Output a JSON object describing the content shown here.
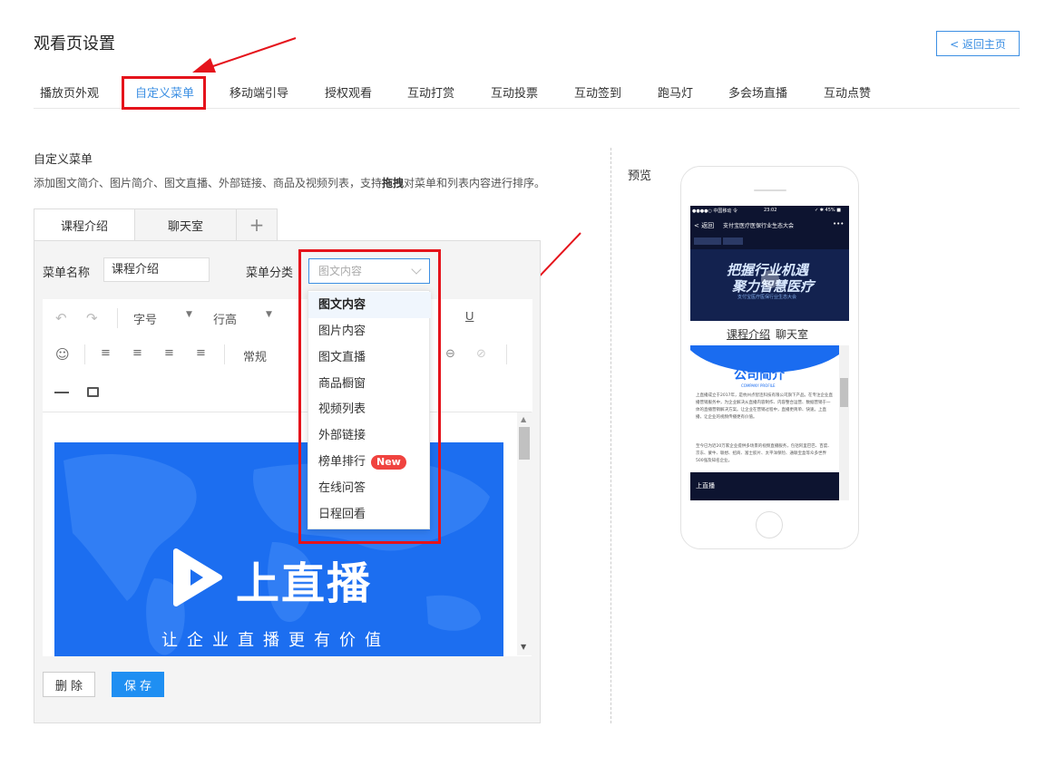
{
  "header": {
    "title": "观看页设置",
    "back_label": "< 返回主页"
  },
  "tabs": [
    {
      "label": "播放页外观"
    },
    {
      "label": "自定义菜单"
    },
    {
      "label": "移动端引导"
    },
    {
      "label": "授权观看"
    },
    {
      "label": "互动打赏"
    },
    {
      "label": "互动投票"
    },
    {
      "label": "互动签到"
    },
    {
      "label": "跑马灯"
    },
    {
      "label": "多会场直播"
    },
    {
      "label": "互动点赞"
    }
  ],
  "section": {
    "title": "自定义菜单",
    "desc_pre": "添加图文简介、图片简介、图文直播、外部链接、商品及视频列表，支持",
    "desc_bold": "拖拽",
    "desc_post": "对菜单和列表内容进行排序。"
  },
  "menu_tabs": [
    {
      "label": "课程介绍"
    },
    {
      "label": "聊天室"
    },
    {
      "label": "+"
    }
  ],
  "form": {
    "name_label": "菜单名称",
    "name_value": "课程介绍",
    "category_label": "菜单分类",
    "category_placeholder": "图文内容"
  },
  "dropdown": {
    "options": [
      {
        "label": "图文内容"
      },
      {
        "label": "图片内容"
      },
      {
        "label": "图文直播"
      },
      {
        "label": "商品橱窗"
      },
      {
        "label": "视频列表"
      },
      {
        "label": "外部链接"
      },
      {
        "label": "榜单排行",
        "badge": "New"
      },
      {
        "label": "在线问答"
      },
      {
        "label": "日程回看"
      }
    ]
  },
  "toolbar": {
    "font_size_label": "字号",
    "line_height_label": "行高",
    "paragraph_label": "常规"
  },
  "banner": {
    "brand": "上直播",
    "slogan": "让企业直播更有价值"
  },
  "buttons": {
    "delete_label": "删 除",
    "save_label": "保 存"
  },
  "preview": {
    "label": "预览",
    "status_carrier": "●●●●○ 中国移动 令",
    "status_time": "23:02",
    "status_battery": "✓ ✱ 45% ■",
    "nav_back": "< 返回",
    "nav_title": "支付宝医疗医保行业生态大会",
    "nav_more": "•••",
    "video_line1": "把握行业机遇",
    "video_line2": "聚力智慧医疗",
    "video_sub": "支付宝医疗医保行业生态大会",
    "tab1": "课程介绍",
    "tab2": "聊天室",
    "card_title": "公司简介",
    "card_subtitle": "COMPANY PROFILE",
    "card_p1": "上直播成立于2017年，是杭州点智连科技有限公司旗下产品。在专注企业直播营销服务中，为企业解决从直播内容制作、内容整合运营、数据营销于一体的直播营销解决方案。让企业在营销过程中，直播更简单、快速。上直播，让企业的视频传播更有价值。",
    "card_p2": "至今已为近20万家企业提供多场景的视频直播服务，包括阿里巴巴、百度、京东、蒙牛、联想、招商、富士胶片、太平洋保险、通联宝盒等众多世界500强及知名企业。",
    "card_footer": "上直播"
  },
  "colors": {
    "accent": "#3c8fe3",
    "highlight": "#e5131b",
    "badge": "#f0433f",
    "banner": "#1c6ef0"
  },
  "icons": [
    "undo-icon",
    "redo-icon",
    "underline-icon",
    "emoji-icon",
    "align-left-icon",
    "align-center-icon",
    "align-right-icon",
    "align-justify-icon",
    "link-icon",
    "unlink-icon",
    "horizontal-rule-icon",
    "image-icon",
    "plus-icon",
    "chevron-down-icon",
    "play-icon",
    "phone-home-button"
  ]
}
